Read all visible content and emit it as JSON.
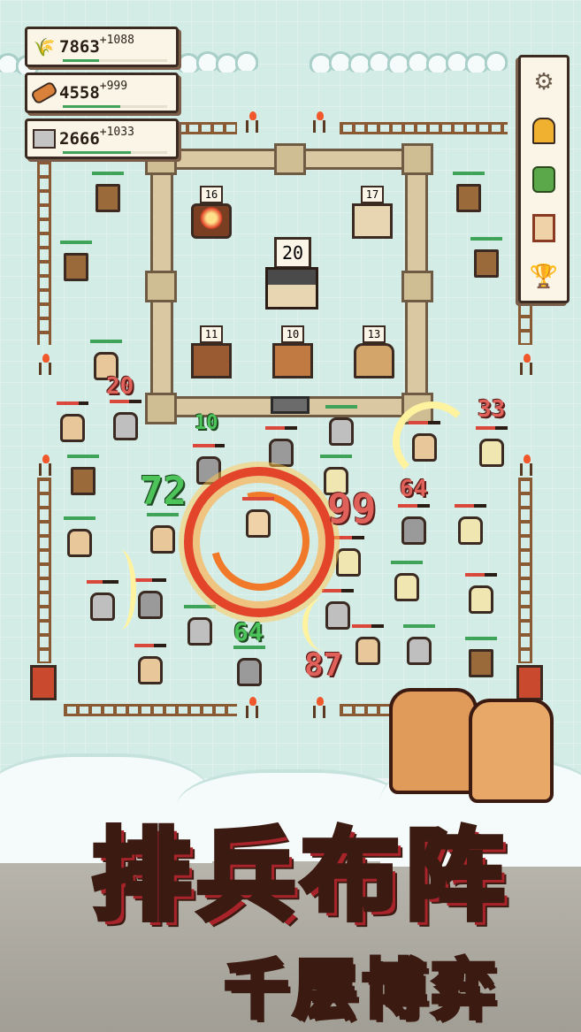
{
  "resources": [
    {
      "icon": "wheat-icon",
      "value": "7863",
      "increment": "+1088",
      "fill": 0.35
    },
    {
      "icon": "wood-log-icon",
      "value": "4558",
      "increment": "+999",
      "fill": 0.55
    },
    {
      "icon": "stone-icon",
      "value": "2666",
      "increment": "+1033",
      "fill": 0.65
    }
  ],
  "menu": [
    {
      "icon": "settings-gear-icon"
    },
    {
      "icon": "hero-profile-icon"
    },
    {
      "icon": "cactus-icon"
    },
    {
      "icon": "scroll-quest-icon"
    },
    {
      "icon": "trophy-icon"
    }
  ],
  "buildings": {
    "b16": "16",
    "b17": "17",
    "b20": "20",
    "b11": "11",
    "b10": "10",
    "b13": "13"
  },
  "damage": {
    "d20": "20",
    "d33": "33",
    "d99": "99",
    "d64a": "64",
    "d87": "87"
  },
  "heals": {
    "h10": "10",
    "h72": "72",
    "h64": "64"
  },
  "title": {
    "main": "排兵布阵",
    "sub": "千层博弈"
  },
  "colors": {
    "hp_green": "#3fa35a",
    "hp_red": "#d9483b",
    "damage_red": "#e0605a",
    "heal_green": "#4cc45a",
    "fire": "#e2452a"
  }
}
